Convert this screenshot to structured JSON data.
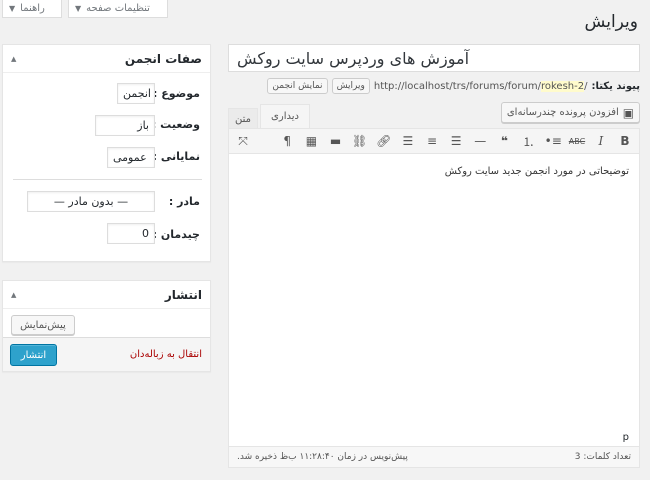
{
  "top_tabs": {
    "screen_options": "تنظیمات صفحه",
    "help": "راهنما"
  },
  "page": {
    "title": "ویرایش"
  },
  "forum_box": {
    "title": "صفات انجمن",
    "type_label": "موضوع :",
    "type_value": "انجمن",
    "status_label": "وضعیت :",
    "status_value": "باز",
    "visibility_label": "نمایانی :",
    "visibility_value": "عمومی",
    "parent_label": "مادر :",
    "parent_value": "— بدون مادر —",
    "order_label": "چیدمان :",
    "order_value": "0"
  },
  "publish_box": {
    "title": "انتشار",
    "preview": "پیش‌نمایش",
    "trash": "انتقال به زباله‌دان",
    "publish": "انتشار"
  },
  "post": {
    "title": "آموزش های وردپرس سایت روکش",
    "permalink_label": "پیوند یکتا:",
    "permalink_base": "http://localhost/trs/forums/forum/",
    "permalink_slug": "rokesh-2",
    "permalink_trail": "/",
    "edit_button": "ویرایش",
    "view_button": "نمایش انجمن"
  },
  "editor": {
    "add_media": "افزودن پرونده چندرسانه‌ای",
    "tab_visual": "دیداری",
    "tab_text": "متن",
    "content": "توضیحاتی در مورد انجمن جدید سایت روکش",
    "path": "p",
    "word_count": "تعداد کلمات: 3",
    "draft_saved": "پیش‌نویس در زمان ۱۱:۲۸:۴۰ ب‌ظ ذخیره شد."
  },
  "toolbar_icons": [
    "fullscreen-icon",
    "paragraph-icon",
    "kitchen-sink-icon",
    "read-more-icon",
    "unlink-icon",
    "link-icon",
    "align-right-icon",
    "align-center-icon",
    "align-left-icon",
    "horizontal-rule-icon",
    "blockquote-icon",
    "numbered-list-icon",
    "bulleted-list-icon",
    "strikethrough-icon",
    "italic-icon",
    "bold-icon"
  ],
  "colors": {
    "accent": "#2ea2cc",
    "trash": "#a00",
    "slug_highlight": "#fffbcc"
  }
}
